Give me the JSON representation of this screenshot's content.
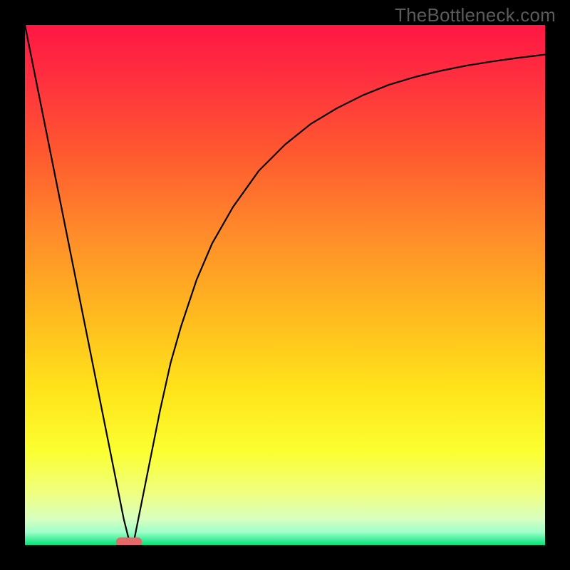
{
  "watermark": "TheBottleneck.com",
  "chart_data": {
    "type": "line",
    "title": "",
    "xlabel": "",
    "ylabel": "",
    "xlim": [
      0,
      100
    ],
    "ylim": [
      0,
      100
    ],
    "background_gradient": {
      "stops": [
        {
          "offset": 0.0,
          "color": "#ff1744"
        },
        {
          "offset": 0.1,
          "color": "#ff2f3f"
        },
        {
          "offset": 0.25,
          "color": "#ff5a2f"
        },
        {
          "offset": 0.4,
          "color": "#ff8b2a"
        },
        {
          "offset": 0.55,
          "color": "#ffb81f"
        },
        {
          "offset": 0.7,
          "color": "#ffe31a"
        },
        {
          "offset": 0.82,
          "color": "#fbff30"
        },
        {
          "offset": 0.9,
          "color": "#f0ff80"
        },
        {
          "offset": 0.95,
          "color": "#d7ffc0"
        },
        {
          "offset": 0.975,
          "color": "#9fffc8"
        },
        {
          "offset": 1.0,
          "color": "#00e47a"
        }
      ]
    },
    "series": [
      {
        "name": "bottleneck-curve",
        "color": "#000000",
        "x": [
          0,
          2,
          4,
          6,
          8,
          10,
          12,
          14,
          16,
          18,
          19,
          20,
          21,
          22,
          24,
          26,
          28,
          30,
          33,
          36,
          40,
          45,
          50,
          55,
          60,
          65,
          70,
          75,
          80,
          85,
          90,
          95,
          100
        ],
        "y": [
          100,
          90,
          80,
          70,
          60,
          50,
          40,
          30,
          20,
          10,
          5,
          1,
          1,
          6,
          16,
          26,
          35,
          42,
          51,
          58,
          65,
          72,
          77,
          81,
          84,
          86.5,
          88.5,
          90,
          91.2,
          92.2,
          93,
          93.7,
          94.3
        ]
      }
    ],
    "marker": {
      "name": "optimal-marker",
      "x": 20,
      "y": 0.6,
      "width": 5,
      "height": 1.7,
      "color": "#e46a6a"
    }
  }
}
